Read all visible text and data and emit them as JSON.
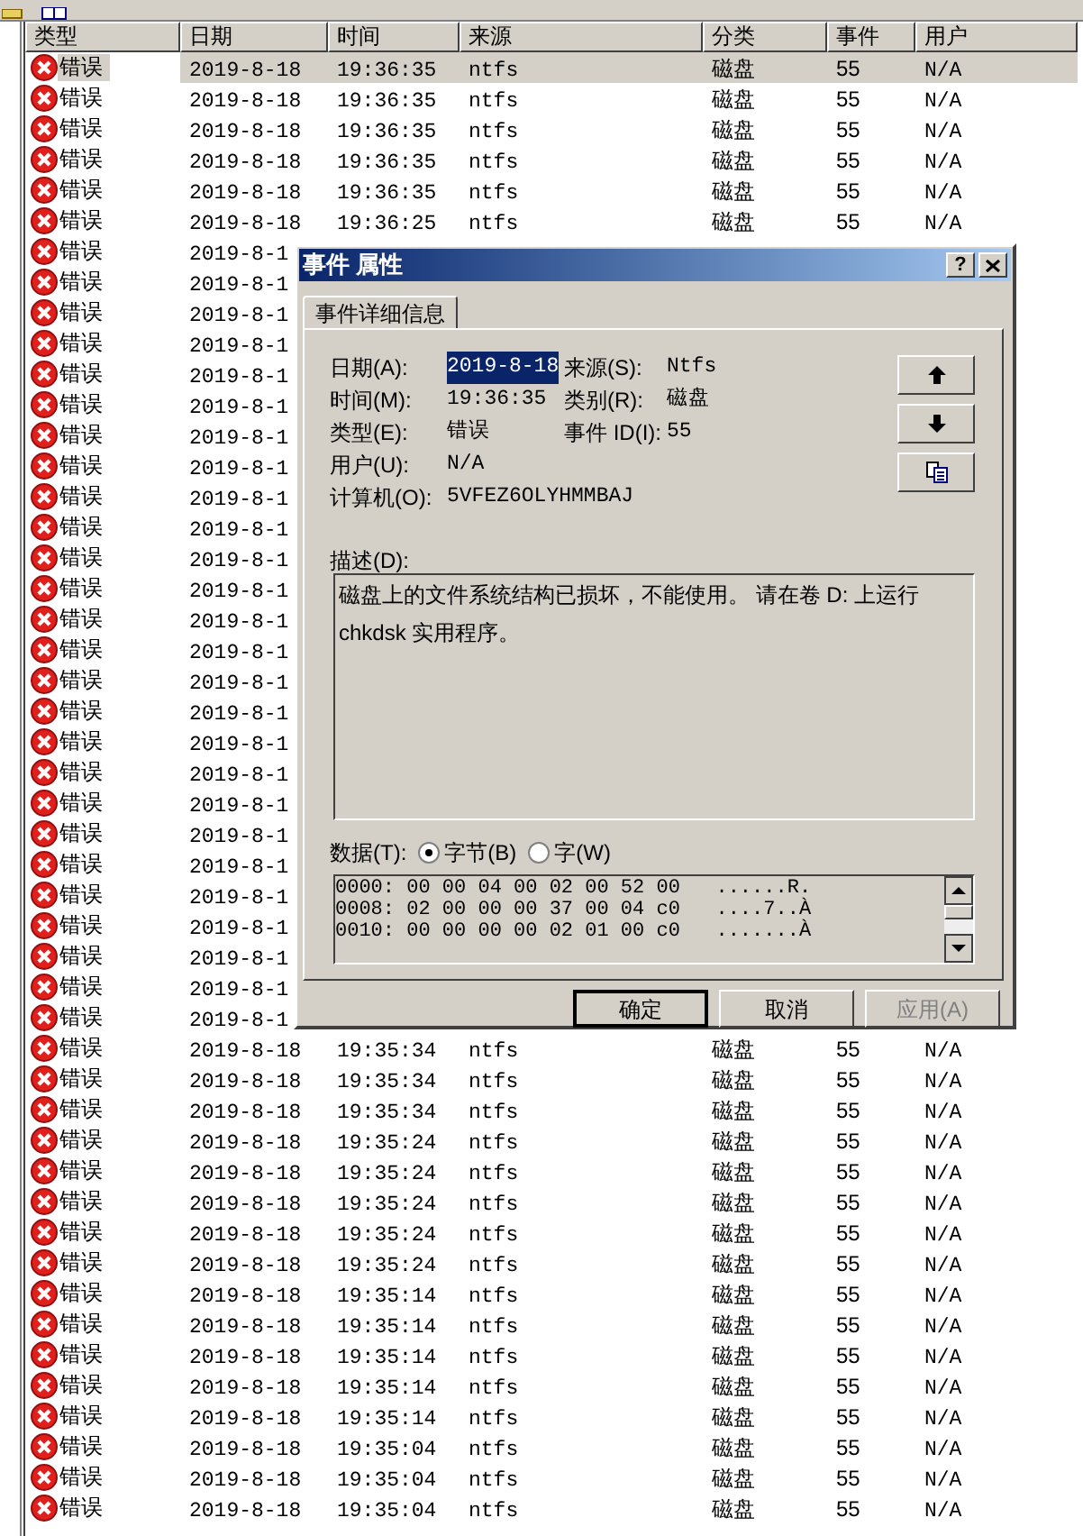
{
  "table": {
    "columns": [
      "类型",
      "日期",
      "时间",
      "来源",
      "分类",
      "事件",
      "用户"
    ],
    "rows": [
      {
        "type": "错误",
        "date": "2019-8-18",
        "time": "19:36:35",
        "source": "ntfs",
        "category": "磁盘",
        "event": "55",
        "user": "N/A",
        "selected": true
      },
      {
        "type": "错误",
        "date": "2019-8-18",
        "time": "19:36:35",
        "source": "ntfs",
        "category": "磁盘",
        "event": "55",
        "user": "N/A",
        "selected": false
      },
      {
        "type": "错误",
        "date": "2019-8-18",
        "time": "19:36:35",
        "source": "ntfs",
        "category": "磁盘",
        "event": "55",
        "user": "N/A",
        "selected": false
      },
      {
        "type": "错误",
        "date": "2019-8-18",
        "time": "19:36:35",
        "source": "ntfs",
        "category": "磁盘",
        "event": "55",
        "user": "N/A",
        "selected": false
      },
      {
        "type": "错误",
        "date": "2019-8-18",
        "time": "19:36:35",
        "source": "ntfs",
        "category": "磁盘",
        "event": "55",
        "user": "N/A",
        "selected": false
      },
      {
        "type": "错误",
        "date": "2019-8-18",
        "time": "19:36:25",
        "source": "ntfs",
        "category": "磁盘",
        "event": "55",
        "user": "N/A",
        "selected": false
      },
      {
        "type": "错误",
        "date": "2019-8-1",
        "selected": false
      },
      {
        "type": "错误",
        "date": "2019-8-1",
        "selected": false
      },
      {
        "type": "错误",
        "date": "2019-8-1",
        "selected": false
      },
      {
        "type": "错误",
        "date": "2019-8-1",
        "selected": false
      },
      {
        "type": "错误",
        "date": "2019-8-1",
        "selected": false
      },
      {
        "type": "错误",
        "date": "2019-8-1",
        "selected": false
      },
      {
        "type": "错误",
        "date": "2019-8-1",
        "selected": false
      },
      {
        "type": "错误",
        "date": "2019-8-1",
        "selected": false
      },
      {
        "type": "错误",
        "date": "2019-8-1",
        "selected": false
      },
      {
        "type": "错误",
        "date": "2019-8-1",
        "selected": false
      },
      {
        "type": "错误",
        "date": "2019-8-1",
        "selected": false
      },
      {
        "type": "错误",
        "date": "2019-8-1",
        "selected": false
      },
      {
        "type": "错误",
        "date": "2019-8-1",
        "selected": false
      },
      {
        "type": "错误",
        "date": "2019-8-1",
        "selected": false
      },
      {
        "type": "错误",
        "date": "2019-8-1",
        "selected": false
      },
      {
        "type": "错误",
        "date": "2019-8-1",
        "selected": false
      },
      {
        "type": "错误",
        "date": "2019-8-1",
        "selected": false
      },
      {
        "type": "错误",
        "date": "2019-8-1",
        "selected": false
      },
      {
        "type": "错误",
        "date": "2019-8-1",
        "selected": false
      },
      {
        "type": "错误",
        "date": "2019-8-1",
        "selected": false
      },
      {
        "type": "错误",
        "date": "2019-8-1",
        "selected": false
      },
      {
        "type": "错误",
        "date": "2019-8-1",
        "selected": false
      },
      {
        "type": "错误",
        "date": "2019-8-1",
        "selected": false
      },
      {
        "type": "错误",
        "date": "2019-8-1",
        "selected": false
      },
      {
        "type": "错误",
        "date": "2019-8-1",
        "selected": false
      },
      {
        "type": "错误",
        "date": "2019-8-1",
        "selected": false
      },
      {
        "type": "错误",
        "date": "2019-8-18",
        "time": "19:35:34",
        "source": "ntfs",
        "category": "磁盘",
        "event": "55",
        "user": "N/A",
        "selected": false
      },
      {
        "type": "错误",
        "date": "2019-8-18",
        "time": "19:35:34",
        "source": "ntfs",
        "category": "磁盘",
        "event": "55",
        "user": "N/A",
        "selected": false
      },
      {
        "type": "错误",
        "date": "2019-8-18",
        "time": "19:35:34",
        "source": "ntfs",
        "category": "磁盘",
        "event": "55",
        "user": "N/A",
        "selected": false
      },
      {
        "type": "错误",
        "date": "2019-8-18",
        "time": "19:35:24",
        "source": "ntfs",
        "category": "磁盘",
        "event": "55",
        "user": "N/A",
        "selected": false
      },
      {
        "type": "错误",
        "date": "2019-8-18",
        "time": "19:35:24",
        "source": "ntfs",
        "category": "磁盘",
        "event": "55",
        "user": "N/A",
        "selected": false
      },
      {
        "type": "错误",
        "date": "2019-8-18",
        "time": "19:35:24",
        "source": "ntfs",
        "category": "磁盘",
        "event": "55",
        "user": "N/A",
        "selected": false
      },
      {
        "type": "错误",
        "date": "2019-8-18",
        "time": "19:35:24",
        "source": "ntfs",
        "category": "磁盘",
        "event": "55",
        "user": "N/A",
        "selected": false
      },
      {
        "type": "错误",
        "date": "2019-8-18",
        "time": "19:35:24",
        "source": "ntfs",
        "category": "磁盘",
        "event": "55",
        "user": "N/A",
        "selected": false
      },
      {
        "type": "错误",
        "date": "2019-8-18",
        "time": "19:35:14",
        "source": "ntfs",
        "category": "磁盘",
        "event": "55",
        "user": "N/A",
        "selected": false
      },
      {
        "type": "错误",
        "date": "2019-8-18",
        "time": "19:35:14",
        "source": "ntfs",
        "category": "磁盘",
        "event": "55",
        "user": "N/A",
        "selected": false
      },
      {
        "type": "错误",
        "date": "2019-8-18",
        "time": "19:35:14",
        "source": "ntfs",
        "category": "磁盘",
        "event": "55",
        "user": "N/A",
        "selected": false
      },
      {
        "type": "错误",
        "date": "2019-8-18",
        "time": "19:35:14",
        "source": "ntfs",
        "category": "磁盘",
        "event": "55",
        "user": "N/A",
        "selected": false
      },
      {
        "type": "错误",
        "date": "2019-8-18",
        "time": "19:35:14",
        "source": "ntfs",
        "category": "磁盘",
        "event": "55",
        "user": "N/A",
        "selected": false
      },
      {
        "type": "错误",
        "date": "2019-8-18",
        "time": "19:35:04",
        "source": "ntfs",
        "category": "磁盘",
        "event": "55",
        "user": "N/A",
        "selected": false
      },
      {
        "type": "错误",
        "date": "2019-8-18",
        "time": "19:35:04",
        "source": "ntfs",
        "category": "磁盘",
        "event": "55",
        "user": "N/A",
        "selected": false
      },
      {
        "type": "错误",
        "date": "2019-8-18",
        "time": "19:35:04",
        "source": "ntfs",
        "category": "磁盘",
        "event": "55",
        "user": "N/A",
        "selected": false
      }
    ]
  },
  "dialog": {
    "title": "事件 属性",
    "help_button": "?",
    "tabs": [
      {
        "label": "事件详细信息",
        "selected": true
      }
    ],
    "fields_left": [
      {
        "label": "日期(A):",
        "value": "2019-8-18",
        "selected": true
      },
      {
        "label": "时间(M):",
        "value": "19:36:35",
        "selected": false
      },
      {
        "label": "类型(E):",
        "value": "错误",
        "selected": false
      },
      {
        "label": "用户(U):",
        "value": "N/A",
        "selected": false
      },
      {
        "label": "计算机(O):",
        "value": "5VFEZ6OLYHMMBAJ",
        "selected": false
      }
    ],
    "fields_right": [
      {
        "label": "来源(S):",
        "value": "Ntfs"
      },
      {
        "label": "类别(R):",
        "value": "磁盘"
      },
      {
        "label": "事件 ID(I):",
        "value": "55"
      }
    ],
    "description_label": "描述(D):",
    "description": "磁盘上的文件系统结构已损坏，不能使用。 请在卷 D: 上运行 chkdsk 实用程序。",
    "data_label": "数据(T):",
    "data_format": [
      {
        "label": "字节(B)",
        "selected": true
      },
      {
        "label": "字(W)",
        "selected": false
      }
    ],
    "data_lines": [
      "0000: 00 00 04 00 02 00 52 00   ......R.",
      "0008: 02 00 00 00 37 00 04 c0   ....7..À",
      "0010: 00 00 00 00 02 01 00 c0   .......À"
    ],
    "buttons": [
      {
        "label": "确定",
        "default": true,
        "disabled": false
      },
      {
        "label": "取消",
        "default": false,
        "disabled": false
      },
      {
        "label": "应用(A)",
        "default": false,
        "disabled": true
      }
    ]
  }
}
